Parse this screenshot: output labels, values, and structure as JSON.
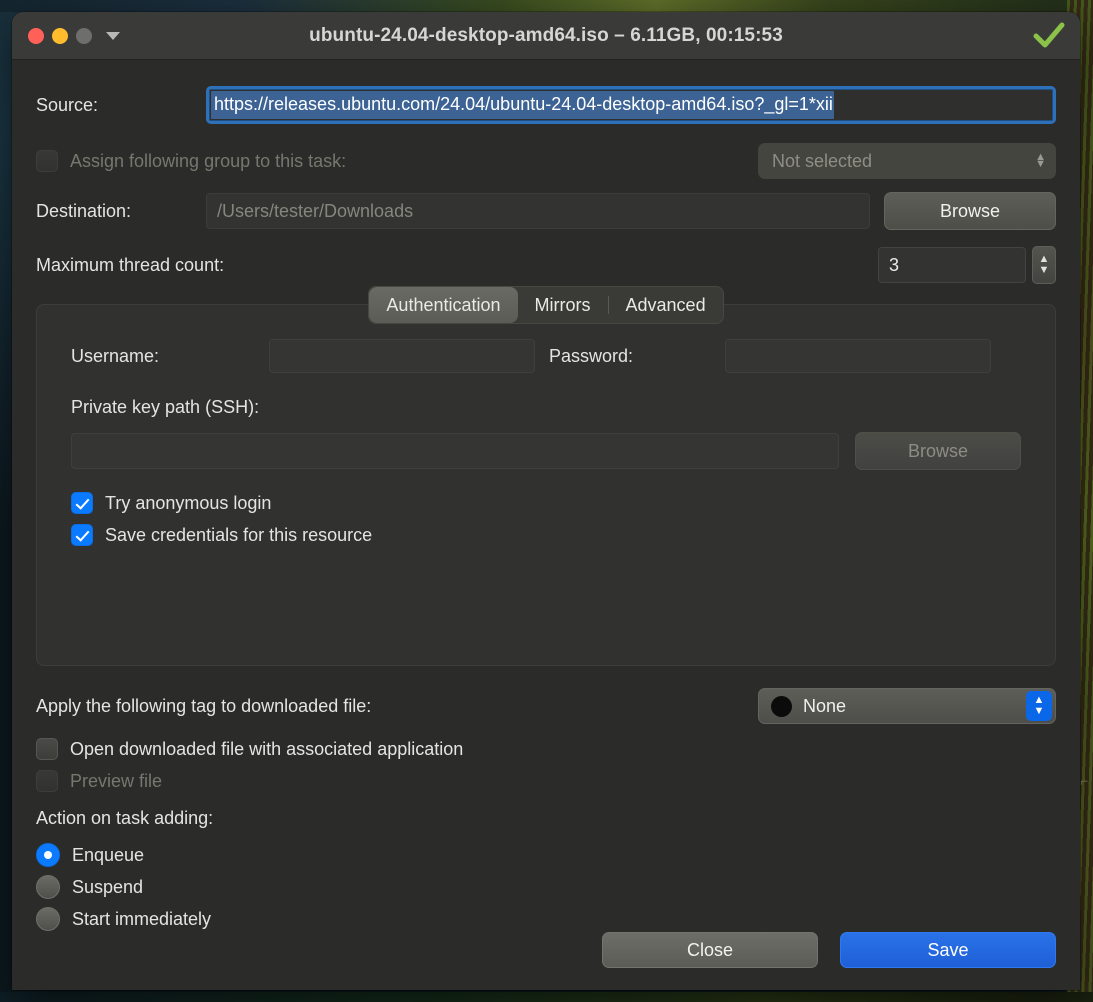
{
  "window": {
    "title": "ubuntu-24.04-desktop-amd64.iso – 6.11GB, 00:15:53",
    "status_icon": "checkmark-icon",
    "traffic_lights": [
      "close",
      "minimize",
      "zoom"
    ],
    "menu_icon": "chevron-down-icon"
  },
  "colors": {
    "accent_blue": "#0a7aff",
    "default_button_blue": "#2a72e8",
    "selection_blue": "#3c6393",
    "focus_ring_blue": "#2f71b8",
    "status_green": "#8bc34a",
    "traffic_red": "#ff6159",
    "traffic_yellow": "#ffbd2e",
    "traffic_gray": "#6e6e6c",
    "window_bg": "#2b2b29",
    "titlebar_bg": "#3a3a38"
  },
  "source": {
    "label": "Source:",
    "value": "https://releases.ubuntu.com/24.04/ubuntu-24.04-desktop-amd64.iso?_gl=1*xii",
    "selected": true
  },
  "group": {
    "checkbox_label": "Assign following group to this task:",
    "checked": false,
    "disabled": true,
    "popup_value": "Not selected",
    "popup_icon": "updown-chevron-icon"
  },
  "destination": {
    "label": "Destination:",
    "placeholder": "/Users/tester/Downloads",
    "value": "",
    "browse_label": "Browse"
  },
  "threads": {
    "label": "Maximum thread count:",
    "value": "3",
    "stepper_up_icon": "chevron-up-icon",
    "stepper_down_icon": "chevron-down-icon"
  },
  "tabs": {
    "items": [
      {
        "label": "Authentication",
        "active": true
      },
      {
        "label": "Mirrors",
        "active": false
      },
      {
        "label": "Advanced",
        "active": false
      }
    ]
  },
  "authentication": {
    "username_label": "Username:",
    "username_value": "",
    "password_label": "Password:",
    "password_value": "",
    "private_key_label": "Private key path (SSH):",
    "private_key_value": "",
    "private_key_browse_label": "Browse",
    "private_key_browse_disabled": true,
    "checkboxes": [
      {
        "label": "Try anonymous login",
        "checked": true,
        "disabled": false
      },
      {
        "label": "Save credentials for this resource",
        "checked": true,
        "disabled": false
      }
    ]
  },
  "tag": {
    "label": "Apply the following tag to downloaded file:",
    "value": "None",
    "swatch_color": "#0b0b0b",
    "popup_icon": "updown-chevron-icon"
  },
  "file_options": [
    {
      "label": "Open downloaded file with associated application",
      "checked": false,
      "disabled": false
    },
    {
      "label": "Preview file",
      "checked": false,
      "disabled": true
    }
  ],
  "action_on_task_adding": {
    "title": "Action on task adding:",
    "options": [
      {
        "label": "Enqueue",
        "selected": true
      },
      {
        "label": "Suspend",
        "selected": false
      },
      {
        "label": "Start immediately",
        "selected": false
      }
    ]
  },
  "footer": {
    "close_label": "Close",
    "save_label": "Save"
  },
  "desktop": {
    "edge_text": "L"
  }
}
